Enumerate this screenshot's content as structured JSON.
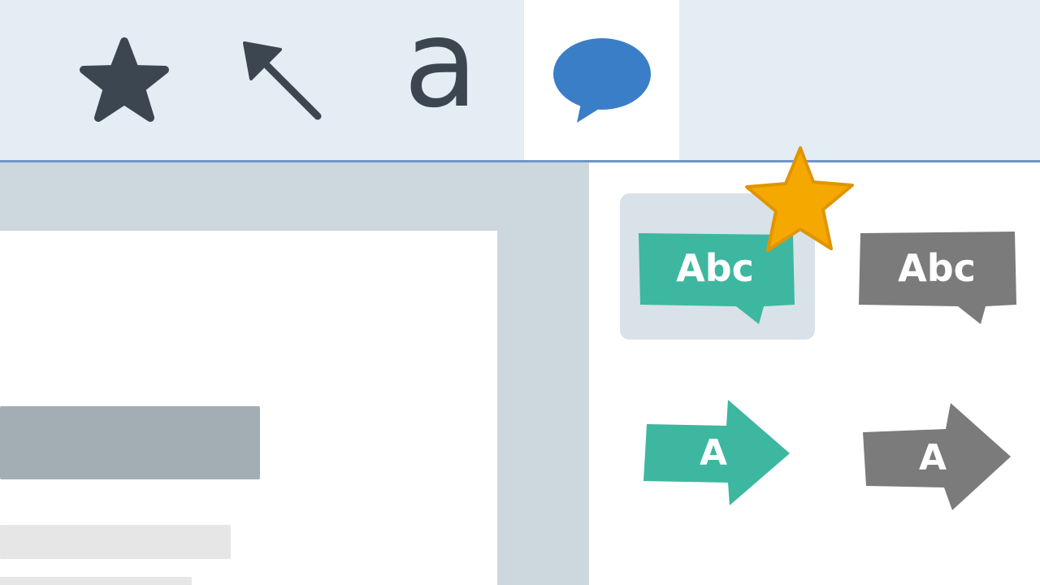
{
  "toolbar": {
    "tools": [
      {
        "icon": "star-icon"
      },
      {
        "icon": "arrow-cursor-icon"
      },
      {
        "icon": "text-tool-icon",
        "glyph": "a"
      },
      {
        "icon": "speech-bubble-icon",
        "selected": true
      }
    ]
  },
  "colors": {
    "toolbar_bg": "#e4ecf4",
    "divider": "#6f95cf",
    "canvas_bg": "#ccd8de",
    "icon_dark": "#3b4651",
    "accent_blue": "#3a7ec8",
    "teal": "#3db7a0",
    "gray": "#7b7b7b",
    "badge_star": "#f5a800"
  },
  "stickers": [
    {
      "shape": "speech-bubble",
      "color": "teal",
      "label": "Abc",
      "selected": true
    },
    {
      "shape": "speech-bubble",
      "color": "gray",
      "label": "Abc"
    },
    {
      "shape": "arrow-tag",
      "color": "teal",
      "label": "A"
    },
    {
      "shape": "arrow-tag",
      "color": "gray",
      "label": "A"
    }
  ],
  "badge": {
    "icon": "favorite-star-icon"
  }
}
